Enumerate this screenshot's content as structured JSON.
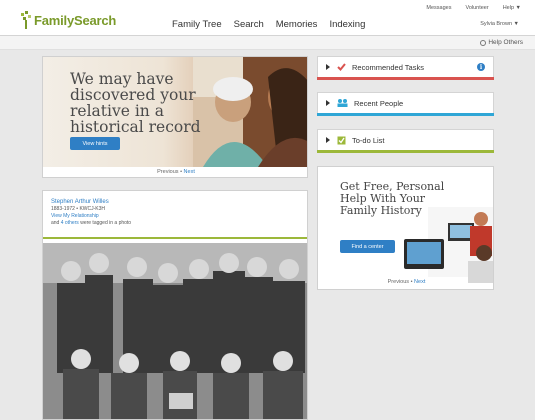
{
  "header": {
    "logo_text": "FamilySearch",
    "nav": [
      "Family Tree",
      "Search",
      "Memories",
      "Indexing"
    ],
    "utility": [
      "Messages",
      "Volunteer",
      "Help ▼"
    ],
    "user": "Sylvia Brown ▼",
    "help_others": "Help Others"
  },
  "hero": {
    "title": "We may have discovered your relative in a historical record",
    "button": "View hints",
    "pager_prev": "Previous",
    "pager_sep": "•",
    "pager_next": "Next"
  },
  "photo_card": {
    "person_name": "Stephen Arthur Willes",
    "person_details": "1883-1972 • KWCJ-K3H",
    "relationship_link": "View My Relationship",
    "tag_prefix": "and",
    "tag_count": "4 others",
    "tag_suffix": "were tagged in a photo"
  },
  "panels": [
    {
      "label": "Recommended Tasks",
      "icon": "check-icon",
      "accent": "#d9534f"
    },
    {
      "label": "Recent People",
      "icon": "people-icon",
      "accent": "#2fa6d6"
    },
    {
      "label": "To-do List",
      "icon": "todo-icon",
      "accent": "#9cb83a"
    }
  ],
  "promo": {
    "title": "Get Free, Personal Help With Your Family History",
    "button": "Find a center",
    "pager_prev": "Previous",
    "pager_sep": "•",
    "pager_next": "Next"
  },
  "colors": {
    "primary_button": "#2f7fc5",
    "brand_green": "#7a9a2a",
    "recommended_bar": "#d9534f",
    "recent_bar": "#2fa6d6",
    "todo_bar": "#9cb83a"
  }
}
